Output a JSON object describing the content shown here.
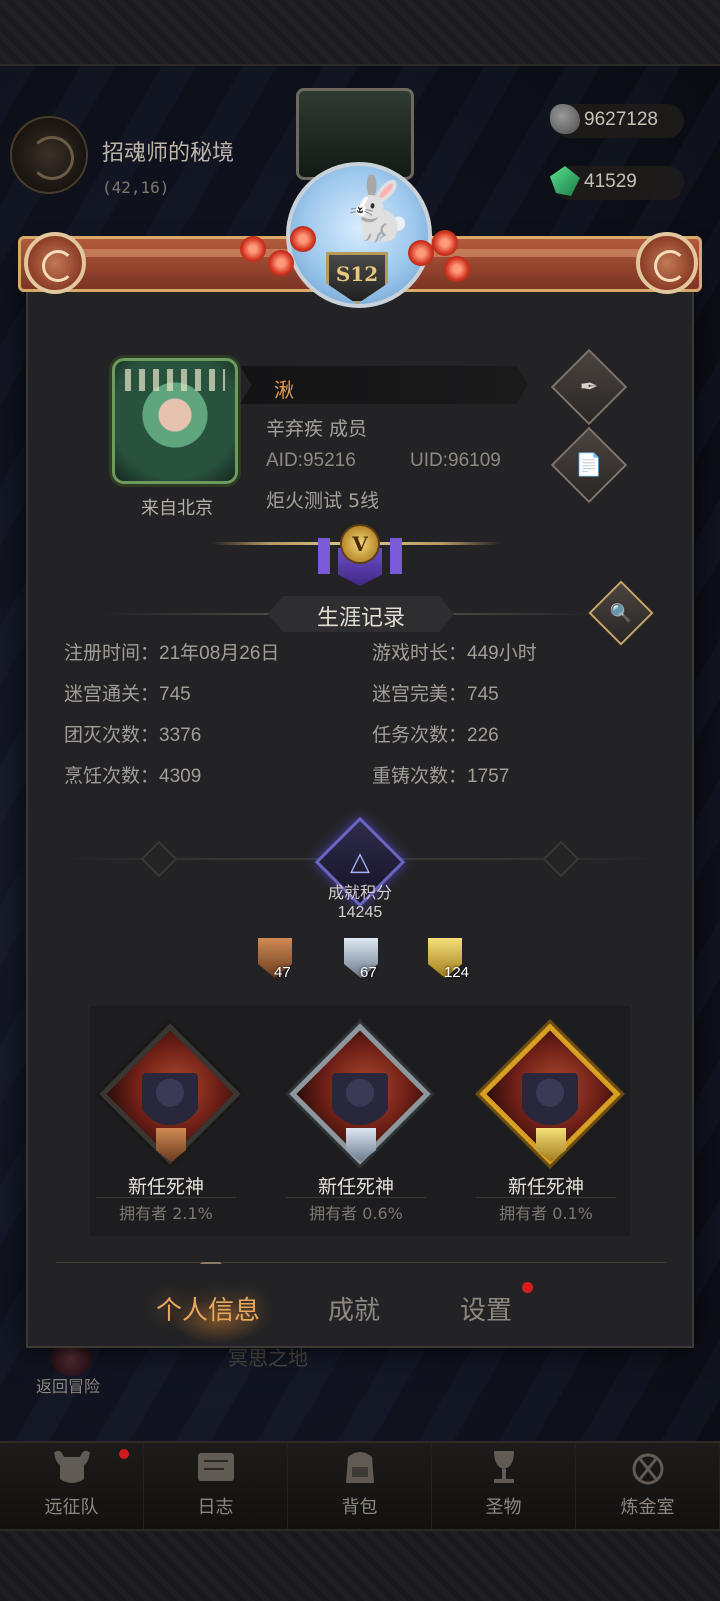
{
  "location": {
    "title": "招魂师的秘境",
    "coords": "(42,16)"
  },
  "resources": [
    {
      "icon": "stone-icon",
      "value": "9627128"
    },
    {
      "icon": "green-gem-icon",
      "value": "41529"
    }
  ],
  "season": {
    "label": "S12"
  },
  "profile": {
    "name": "湫",
    "from": "来自北京",
    "guild": "辛弃疾 成员",
    "aid": "AID:95216",
    "uid": "UID:96109",
    "server": "炬火测试 5线",
    "vip_label": "V"
  },
  "career": {
    "title": "生涯记录",
    "stats": [
      {
        "label": "注册时间：",
        "value": "21年08月26日"
      },
      {
        "label": "游戏时长：",
        "value": "449小时"
      },
      {
        "label": "迷宫通关：",
        "value": "745"
      },
      {
        "label": "迷宫完美：",
        "value": "745"
      },
      {
        "label": "团灭次数：",
        "value": "3376"
      },
      {
        "label": "任务次数：",
        "value": "226"
      },
      {
        "label": "烹饪次数：",
        "value": "4309"
      },
      {
        "label": "重铸次数：",
        "value": "1757"
      }
    ]
  },
  "achievement": {
    "label": "成就积分",
    "score": "14245",
    "tiers": [
      {
        "tier": "bronze",
        "count": "47"
      },
      {
        "tier": "silver",
        "count": "67"
      },
      {
        "tier": "gold",
        "count": "124"
      }
    ],
    "cards": [
      {
        "tier": "bronze",
        "name": "新任死神",
        "owners": "拥有者 2.1%"
      },
      {
        "tier": "silver",
        "name": "新任死神",
        "owners": "拥有者 0.6%"
      },
      {
        "tier": "gold",
        "name": "新任死神",
        "owners": "拥有者 0.1%"
      }
    ]
  },
  "tabs": [
    {
      "label": "个人信息",
      "active": true
    },
    {
      "label": "成就",
      "active": false
    },
    {
      "label": "设置",
      "active": false,
      "badge": true
    }
  ],
  "background": {
    "return_label": "返回冒险",
    "sign_text": "冥思之地"
  },
  "bottom_nav": [
    {
      "label": "远征队",
      "icon": "helmet-icon",
      "badge": true
    },
    {
      "label": "日志",
      "icon": "scroll-icon",
      "badge": false
    },
    {
      "label": "背包",
      "icon": "backpack-icon",
      "badge": false
    },
    {
      "label": "圣物",
      "icon": "chalice-icon",
      "badge": false
    },
    {
      "label": "炼金室",
      "icon": "alchemy-icon",
      "badge": false
    }
  ],
  "colors": {
    "accent_orange": "#e7a85e",
    "badge_red": "#d81d1d",
    "panel_bg": "#232325"
  }
}
